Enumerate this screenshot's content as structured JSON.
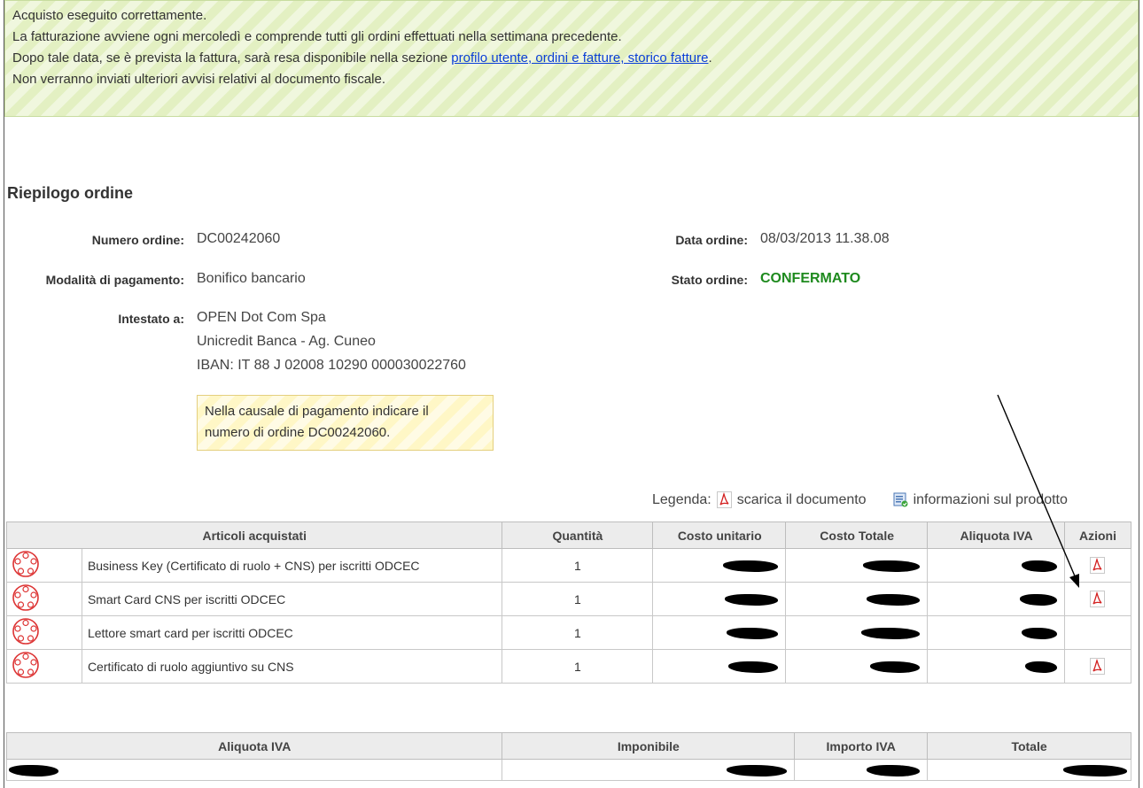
{
  "banner": {
    "line1": "Acquisto eseguito correttamente.",
    "line2": "La fatturazione avviene ogni mercoledì e comprende tutti gli ordini effettuati nella settimana precedente.",
    "line3_prefix": "Dopo tale data, se è prevista la fattura, sarà resa disponibile nella sezione ",
    "line3_link": "profilo utente, ordini e fatture, storico fatture",
    "line3_suffix": ".",
    "line4": "Non verranno inviati ulteriori avvisi relativi al documento fiscale."
  },
  "summary_title": "Riepilogo ordine",
  "order": {
    "number_label": "Numero ordine:",
    "number_value": "DC00242060",
    "date_label": "Data ordine:",
    "date_value": "08/03/2013 11.38.08",
    "payment_label": "Modalità di pagamento:",
    "payment_value": "Bonifico bancario",
    "status_label": "Stato ordine:",
    "status_value": "CONFERMATO",
    "payee_label": "Intestato a:",
    "payee_line1": "OPEN Dot Com Spa",
    "payee_line2": "Unicredit Banca - Ag. Cuneo",
    "payee_line3": "IBAN: IT 88 J 02008 10290 000030022760",
    "note_line1": "Nella causale di pagamento indicare il",
    "note_line2": "numero di ordine DC00242060."
  },
  "legend": {
    "label": "Legenda:",
    "download": "scarica il documento",
    "info": "informazioni sul prodotto"
  },
  "items_table": {
    "headers": [
      "Articoli acquistati",
      "Quantità",
      "Costo unitario",
      "Costo Totale",
      "Aliquota IVA",
      "Azioni"
    ],
    "rows": [
      {
        "name": "Business Key (Certificato di ruolo + CNS) per iscritti ODCEC",
        "qty": "1"
      },
      {
        "name": "Smart Card CNS per iscritti ODCEC",
        "qty": "1"
      },
      {
        "name": "Lettore smart card per iscritti ODCEC",
        "qty": "1"
      },
      {
        "name": "Certificato di ruolo aggiuntivo su CNS",
        "qty": "1"
      }
    ]
  },
  "summary_table": {
    "headers": [
      "Aliquota IVA",
      "Imponibile",
      "Importo IVA",
      "Totale"
    ]
  },
  "icons": {
    "pdf": "pdf-download-icon",
    "info": "product-info-icon",
    "thumb": "odcec-logo-icon"
  },
  "colors": {
    "success_bg": "#e3f0c2",
    "note_bg": "#fff7c6",
    "status": "#1e8a1e",
    "link": "#0b3fd6",
    "pdf": "#d32020"
  }
}
